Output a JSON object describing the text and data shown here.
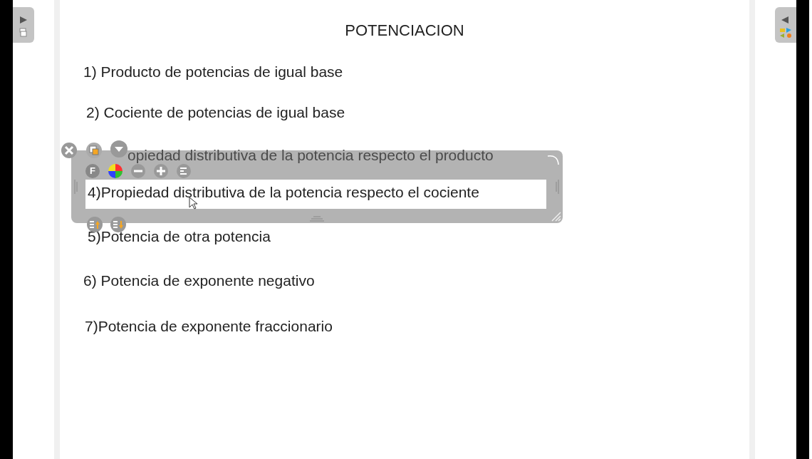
{
  "title": "POTENCIACION",
  "items": [
    {
      "text": "1) Producto de potencias de igual base",
      "selected": false
    },
    {
      "text": "2) Cociente de potencias de igual base",
      "selected": false
    },
    {
      "text": "opiedad distributiva de la potencia respecto el producto",
      "selected": false
    },
    {
      "text": "4)Propiedad distributiva de la potencia respecto el cociente",
      "selected": true
    },
    {
      "text": "5)Potencia de otra potencia",
      "selected": false
    },
    {
      "text": "6) Potencia de exponente negativo",
      "selected": false
    },
    {
      "text": "7)Potencia de exponente fraccionario",
      "selected": false
    }
  ],
  "font_button_label": "F"
}
